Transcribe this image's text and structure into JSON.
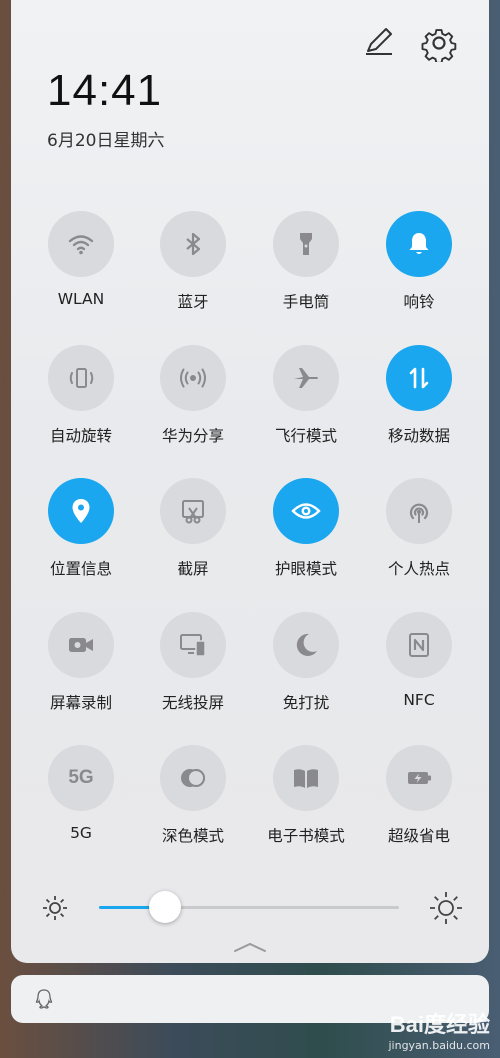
{
  "status": {
    "time": "14:41",
    "date": "6月20日星期六"
  },
  "header": {
    "edit_icon": "pencil-icon",
    "settings_icon": "gear-icon"
  },
  "tiles": [
    {
      "label": "WLAN",
      "icon": "wifi-icon",
      "on": false
    },
    {
      "label": "蓝牙",
      "icon": "bluetooth-icon",
      "on": false
    },
    {
      "label": "手电筒",
      "icon": "flashlight-icon",
      "on": false
    },
    {
      "label": "响铃",
      "icon": "bell-icon",
      "on": true
    },
    {
      "label": "自动旋转",
      "icon": "auto-rotate-icon",
      "on": false
    },
    {
      "label": "华为分享",
      "icon": "huawei-share-icon",
      "on": false
    },
    {
      "label": "飞行模式",
      "icon": "airplane-icon",
      "on": false
    },
    {
      "label": "移动数据",
      "icon": "mobile-data-icon",
      "on": true
    },
    {
      "label": "位置信息",
      "icon": "location-icon",
      "on": true
    },
    {
      "label": "截屏",
      "icon": "screenshot-icon",
      "on": false
    },
    {
      "label": "护眼模式",
      "icon": "eye-icon",
      "on": true
    },
    {
      "label": "个人热点",
      "icon": "hotspot-icon",
      "on": false
    },
    {
      "label": "屏幕录制",
      "icon": "screen-record-icon",
      "on": false
    },
    {
      "label": "无线投屏",
      "icon": "wireless-projection-icon",
      "on": false
    },
    {
      "label": "免打扰",
      "icon": "moon-icon",
      "on": false
    },
    {
      "label": "NFC",
      "icon": "nfc-icon",
      "on": false
    },
    {
      "label": "5G",
      "icon": "5g-icon",
      "icon_text": "5G",
      "on": false
    },
    {
      "label": "深色模式",
      "icon": "dark-mode-icon",
      "on": false
    },
    {
      "label": "电子书模式",
      "icon": "ebook-icon",
      "on": false
    },
    {
      "label": "超级省电",
      "icon": "power-saving-icon",
      "on": false
    }
  ],
  "brightness": {
    "level": 0.22,
    "accent": "#1aa7ef"
  },
  "colors": {
    "tile_off": "#d9dadd",
    "tile_on": "#1aa7ef"
  },
  "watermark": {
    "logo": "Bai度经验",
    "url": "jingyan.baidu.com"
  }
}
